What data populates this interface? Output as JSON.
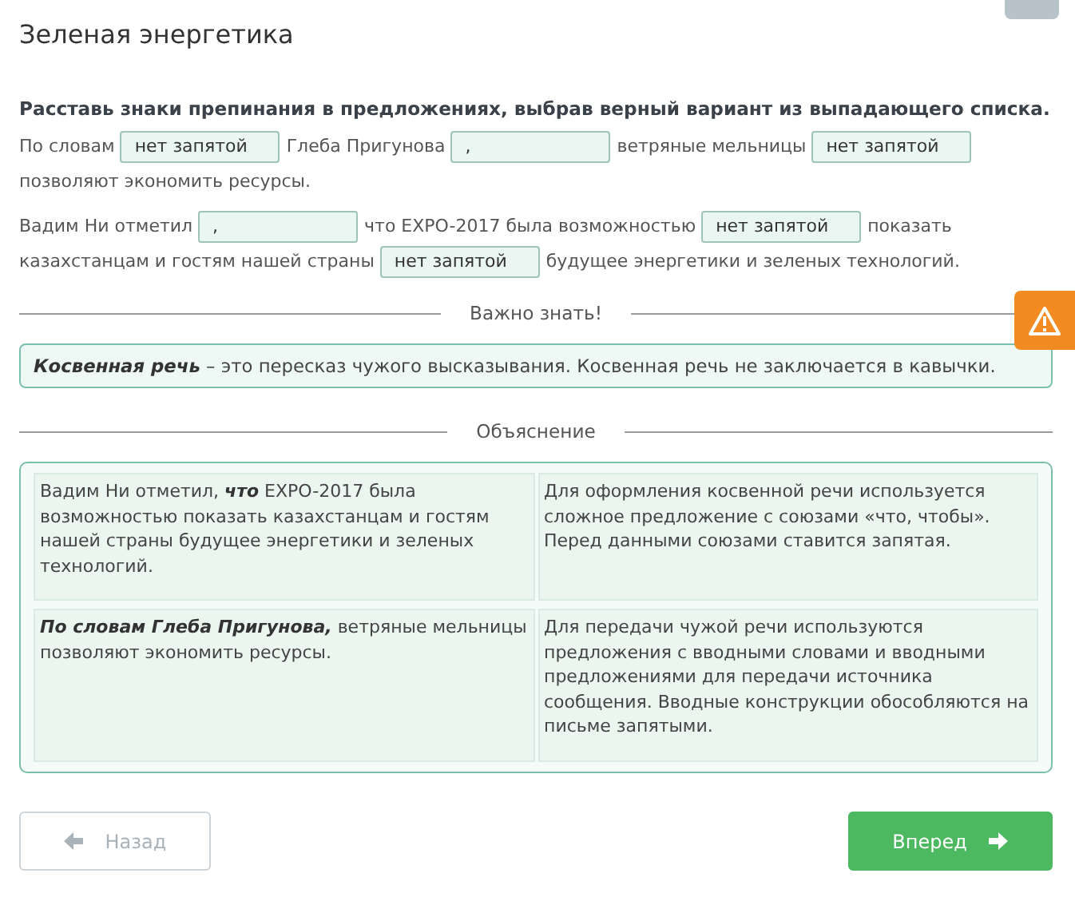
{
  "title": "Зеленая энергетика",
  "instruction": "Расставь знаки препинания в предложениях, выбрав верный вариант из выпадающего списка.",
  "sentences": [
    {
      "segments": [
        {
          "kind": "text",
          "text": "По словам"
        },
        {
          "kind": "select",
          "value": "нет запятой"
        },
        {
          "kind": "text",
          "text": "Глеба Пригунова"
        },
        {
          "kind": "select",
          "value": ","
        },
        {
          "kind": "text",
          "text": "ветряные мельницы"
        },
        {
          "kind": "select",
          "value": "нет запятой"
        },
        {
          "kind": "text",
          "text": "позволяют экономить ресурсы."
        }
      ]
    },
    {
      "segments": [
        {
          "kind": "text",
          "text": "Вадим Ни отметил"
        },
        {
          "kind": "select",
          "value": ","
        },
        {
          "kind": "text",
          "text": "что EXPO-2017 была возможностью"
        },
        {
          "kind": "select",
          "value": "нет запятой"
        },
        {
          "kind": "text",
          "text": "показать"
        },
        {
          "kind": "text",
          "text": "казахстанцам и гостям нашей страны"
        },
        {
          "kind": "select",
          "value": "нет запятой"
        },
        {
          "kind": "text",
          "text": "будущее энергетики и зеленых технологий."
        }
      ]
    }
  ],
  "important": {
    "heading": "Важно знать!",
    "text": "**Косвенная речь** – это пересказ чужого высказывания. Косвенная речь не заключается в кавычки."
  },
  "explanation": {
    "heading": "Объяснение",
    "rows": [
      [
        "Вадим Ни отметил, **что** EXPO-2017 была возможностью показать казахстанцам и гостям нашей страны будущее энергетики и зеленых технологий.",
        "Для оформления косвенной речи используется сложное предложение с союзами «что, чтобы». Перед данными союзами ставится запятая."
      ],
      [
        "**По словам Глеба Пригунова,** ветряные мельницы позволяют экономить ресурсы.",
        "Для передачи чужой речи используются предложения с вводными словами и вводными предложениями для передачи источника сообщения. Вводные конструкции обособляются на письме запятыми."
      ]
    ]
  },
  "nav": [
    {
      "kind": "back",
      "label": "Назад",
      "disabled": true
    },
    {
      "kind": "next",
      "label": "Вперед",
      "disabled": false
    }
  ]
}
